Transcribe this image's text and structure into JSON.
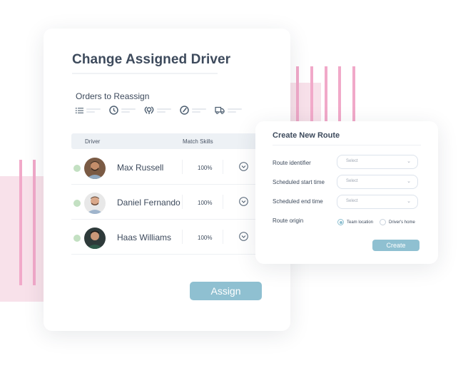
{
  "main_card": {
    "title": "Change Assigned Driver",
    "orders_label": "Orders to Reassign",
    "order_icons": [
      "list-icon",
      "clock-icon",
      "map-pin-icon",
      "speedometer-icon",
      "truck-icon"
    ],
    "table": {
      "headers": [
        "Driver",
        "Match Skills"
      ],
      "rows": [
        {
          "name": "Max Russell",
          "match": "100%",
          "status_color": "#c3e0c2"
        },
        {
          "name": "Daniel Fernando",
          "match": "100%",
          "status_color": "#c3e0c2"
        },
        {
          "name": "Haas Williams",
          "match": "100%",
          "status_color": "#c3e0c2"
        }
      ]
    },
    "assign_label": "Assign"
  },
  "route_card": {
    "title": "Create New Route",
    "fields": [
      {
        "label": "Route identifier",
        "value": "Select"
      },
      {
        "label": "Scheduled start time",
        "value": "Select"
      },
      {
        "label": "Scheduled end time",
        "value": "Select"
      }
    ],
    "origin_label": "Route origin",
    "origin_options": [
      {
        "label": "Team location",
        "selected": true
      },
      {
        "label": "Driver's home",
        "selected": false
      }
    ],
    "create_label": "Create"
  },
  "colors": {
    "accent": "#8fc0d1",
    "text": "#3d4a5c",
    "status_online": "#c3e0c2",
    "decor_pink": "#f1a9c9"
  }
}
